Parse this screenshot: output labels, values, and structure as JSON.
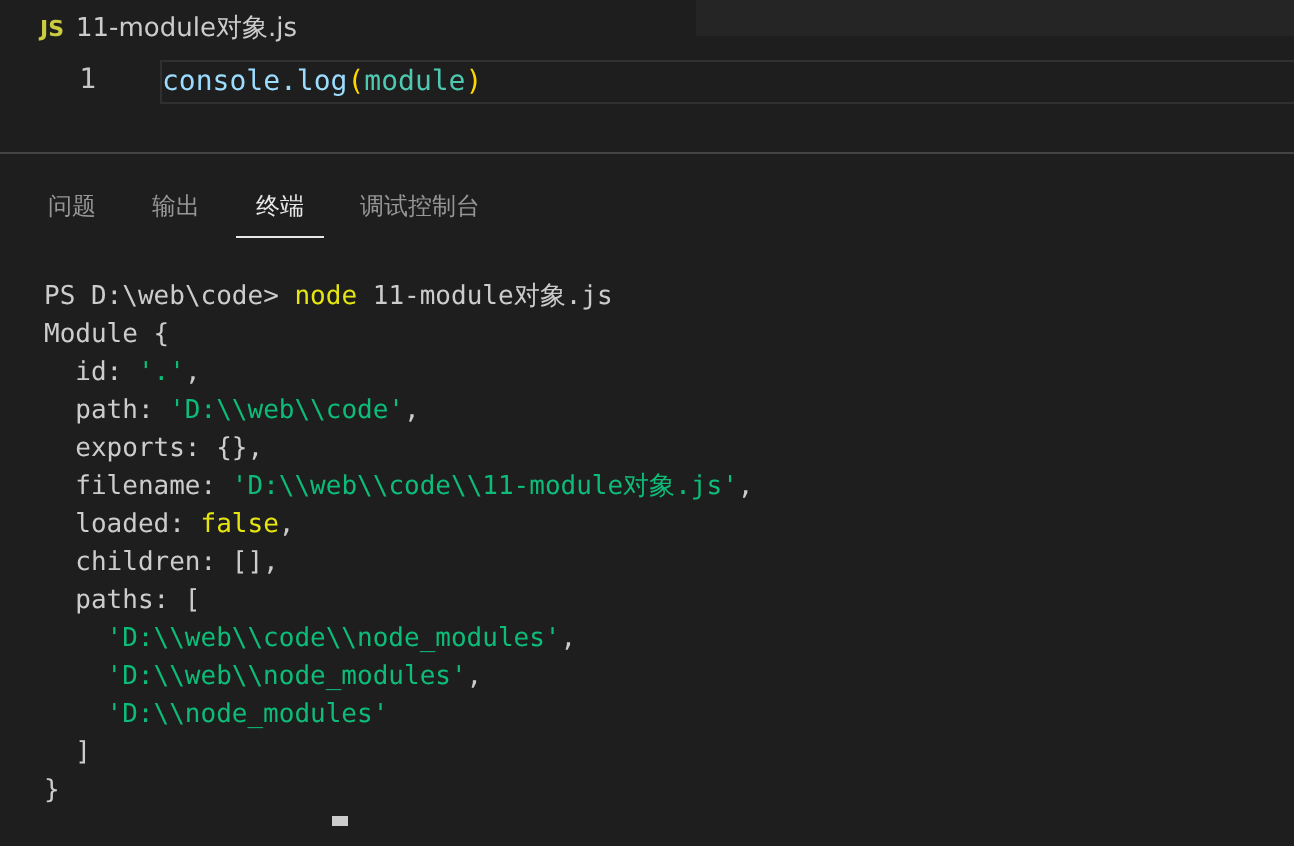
{
  "editor": {
    "tab": {
      "icon_text": "JS",
      "title": "11-module对象.js"
    },
    "lines": [
      {
        "number": "1",
        "segments": [
          {
            "kind": "member",
            "text": "console.log"
          },
          {
            "kind": "bracket",
            "text": "("
          },
          {
            "kind": "variable",
            "text": "module"
          },
          {
            "kind": "bracket",
            "text": ")"
          }
        ]
      }
    ]
  },
  "panel": {
    "tabs": [
      {
        "label": "问题",
        "selected": false
      },
      {
        "label": "输出",
        "selected": false
      },
      {
        "label": "终端",
        "selected": true
      },
      {
        "label": "调试控制台",
        "selected": false
      }
    ]
  },
  "terminal": {
    "lines": [
      {
        "segments": [
          {
            "kind": "plain",
            "text": "PS D:\\web\\code> "
          },
          {
            "kind": "command",
            "text": "node"
          },
          {
            "kind": "plain",
            "text": " 11-module对象.js"
          }
        ]
      },
      {
        "segments": [
          {
            "kind": "plain",
            "text": "Module {"
          }
        ],
        "children": [
          {
            "segments": [
              {
                "kind": "plain",
                "text": "id: "
              },
              {
                "kind": "string",
                "text": "'.'"
              },
              {
                "kind": "plain",
                "text": ","
              }
            ]
          },
          {
            "segments": [
              {
                "kind": "plain",
                "text": "path: "
              },
              {
                "kind": "string",
                "text": "'D:\\\\web\\\\code'"
              },
              {
                "kind": "plain",
                "text": ","
              }
            ]
          },
          {
            "segments": [
              {
                "kind": "plain",
                "text": "exports: {},"
              }
            ]
          },
          {
            "segments": [
              {
                "kind": "plain",
                "text": "filename: "
              },
              {
                "kind": "string",
                "text": "'D:\\\\web\\\\code\\\\11-module对象.js'"
              },
              {
                "kind": "plain",
                "text": ","
              }
            ]
          },
          {
            "segments": [
              {
                "kind": "plain",
                "text": "loaded: "
              },
              {
                "kind": "keyword",
                "text": "false"
              },
              {
                "kind": "plain",
                "text": ","
              }
            ]
          },
          {
            "segments": [
              {
                "kind": "plain",
                "text": "children: [],"
              }
            ]
          },
          {
            "segments": [
              {
                "kind": "plain",
                "text": "paths: ["
              }
            ],
            "children": [
              {
                "segments": [
                  {
                    "kind": "string",
                    "text": "'D:\\\\web\\\\code\\\\node_modules'"
                  },
                  {
                    "kind": "plain",
                    "text": ","
                  }
                ]
              },
              {
                "segments": [
                  {
                    "kind": "string",
                    "text": "'D:\\\\web\\\\node_modules'"
                  },
                  {
                    "kind": "plain",
                    "text": ","
                  }
                ]
              },
              {
                "segments": [
                  {
                    "kind": "string",
                    "text": "'D:\\\\node_modules'"
                  }
                ]
              }
            ]
          },
          {
            "segments": [
              {
                "kind": "plain",
                "text": "]"
              }
            ]
          }
        ]
      },
      {
        "segments": [
          {
            "kind": "plain",
            "text": "}"
          }
        ]
      }
    ],
    "cursor": true
  }
}
